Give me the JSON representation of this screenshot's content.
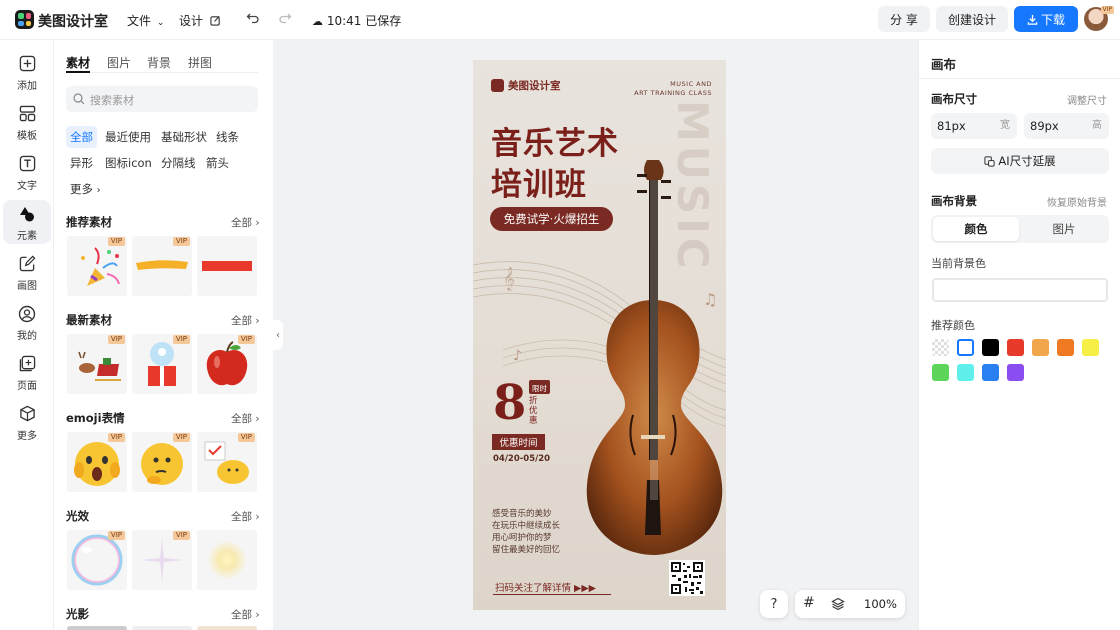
{
  "topbar": {
    "app_title": "美图设计室",
    "file_menu": "文件",
    "design_menu": "设计",
    "save_status": "10:41 已保存",
    "share_label": "分 享",
    "create_label": "创建设计",
    "download_label": "下载",
    "avatar_badge": "VIP"
  },
  "leftnav": [
    {
      "label": "添加",
      "icon": "plus-square-icon"
    },
    {
      "label": "模板",
      "icon": "template-icon"
    },
    {
      "label": "文字",
      "icon": "text-icon"
    },
    {
      "label": "元素",
      "icon": "shapes-icon"
    },
    {
      "label": "画图",
      "icon": "draw-icon"
    },
    {
      "label": "我的",
      "icon": "user-icon"
    },
    {
      "label": "页面",
      "icon": "page-add-icon"
    },
    {
      "label": "更多",
      "icon": "cube-icon"
    }
  ],
  "panel": {
    "tabs": [
      "素材",
      "图片",
      "背景",
      "拼图"
    ],
    "search_placeholder": "搜索素材",
    "chips_row1": [
      "全部",
      "最近使用",
      "基础形状",
      "线条"
    ],
    "chips_row2": [
      "异形",
      "图标icon",
      "分隔线",
      "箭头"
    ],
    "more_chip": "更多",
    "sections": [
      {
        "title": "推荐素材",
        "all": "全部"
      },
      {
        "title": "最新素材",
        "all": "全部"
      },
      {
        "title": "emoji表情",
        "all": "全部"
      },
      {
        "title": "光效",
        "all": "全部"
      },
      {
        "title": "光影",
        "all": "全部"
      }
    ],
    "vip_label": "VIP"
  },
  "poster": {
    "brand": "美图设计室",
    "en_line1": "MUSIC AND",
    "en_line2": "ART TRAINING CLASS",
    "title_line1": "音乐艺术",
    "title_line2": "培训班",
    "subtitle": "免费试学·火爆招生",
    "vertical_word": "MUSIC",
    "discount_number": "8",
    "limited": "限时",
    "discount_char1": "折",
    "discount_char2": "优",
    "discount_char3": "惠",
    "promo_label": "优惠时间",
    "date_range": "04/20-05/20",
    "desc_lines": [
      "感受音乐的美妙",
      "在玩乐中继续成长",
      "用心呵护你的梦",
      "留住最美好的回忆"
    ],
    "footer_text": "扫码关注了解详情 ▶▶▶"
  },
  "right": {
    "title": "画布",
    "size_label": "画布尺寸",
    "size_action": "调整尺寸",
    "width_value": "81px",
    "width_unit": "宽",
    "height_value": "89px",
    "height_unit": "高",
    "ai_expand": "AI尺寸延展",
    "bg_label": "画布背景",
    "bg_reset": "恢复原始背景",
    "toggle_color": "颜色",
    "toggle_image": "图片",
    "current_bg": "当前背景色",
    "recommended": "推荐颜色",
    "swatches": [
      "transparent",
      "#ffffff",
      "#000000",
      "#e83a2b",
      "#f2a64b",
      "#f07a24",
      "#f6f046",
      "#5dd45a",
      "#5ff0ec",
      "#2a80f0",
      "#8a4ef0"
    ]
  },
  "bottom": {
    "help": "?",
    "zoom": "100%"
  }
}
